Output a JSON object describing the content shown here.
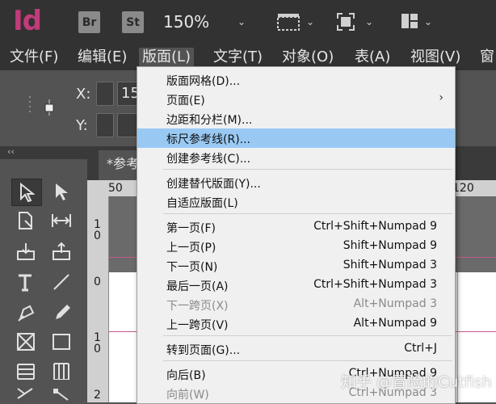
{
  "app": {
    "logo": "Id",
    "bridge": "Br",
    "stock": "St",
    "zoom": "150%"
  },
  "menubar": [
    {
      "label": "文件(F)"
    },
    {
      "label": "编辑(E)"
    },
    {
      "label": "版面(L)"
    },
    {
      "label": "文字(T)"
    },
    {
      "label": "对象(O)"
    },
    {
      "label": "表(A)"
    },
    {
      "label": "视图(V)"
    },
    {
      "label": "窗"
    }
  ],
  "control": {
    "x_label": "X:",
    "y_label": "Y:",
    "x_value": "15"
  },
  "tools_header": "‹‹",
  "document": {
    "tab_title": "*参考",
    "ruler_h": [
      "50",
      "120"
    ],
    "ruler_v": [
      "1\n0",
      "0",
      "1\n0",
      "2"
    ]
  },
  "menu": {
    "items": [
      {
        "label": "版面网格(D)..."
      },
      {
        "label": "页面(E)",
        "submenu": true
      },
      {
        "label": "边距和分栏(M)..."
      },
      {
        "label": "标尺参考线(R)...",
        "highlighted": true
      },
      {
        "label": "创建参考线(C)..."
      },
      {
        "label": "创建替代版面(Y)..."
      },
      {
        "label": "自适应版面(L)"
      },
      {
        "label": "第一页(F)",
        "shortcut": "Ctrl+Shift+Numpad 9"
      },
      {
        "label": "上一页(P)",
        "shortcut": "Shift+Numpad 9"
      },
      {
        "label": "下一页(N)",
        "shortcut": "Shift+Numpad 3"
      },
      {
        "label": "最后一页(A)",
        "shortcut": "Ctrl+Shift+Numpad 3"
      },
      {
        "label": "下一跨页(X)",
        "shortcut": "Alt+Numpad 3",
        "disabled": true
      },
      {
        "label": "上一跨页(V)",
        "shortcut": "Alt+Numpad 9"
      },
      {
        "label": "转到页面(G)...",
        "shortcut": "Ctrl+J"
      },
      {
        "label": "向后(B)",
        "shortcut": "Ctrl+Numpad 9"
      },
      {
        "label": "向前(W)",
        "shortcut": "Ctrl+Numpad 3",
        "disabled": true
      }
    ]
  },
  "watermark": "知乎 @冒险的Cutfish",
  "colors": {
    "accent": "#c23b7a",
    "highlight": "#99c9f3",
    "menu_bg": "#f0f0f0",
    "chrome": "#323232"
  }
}
